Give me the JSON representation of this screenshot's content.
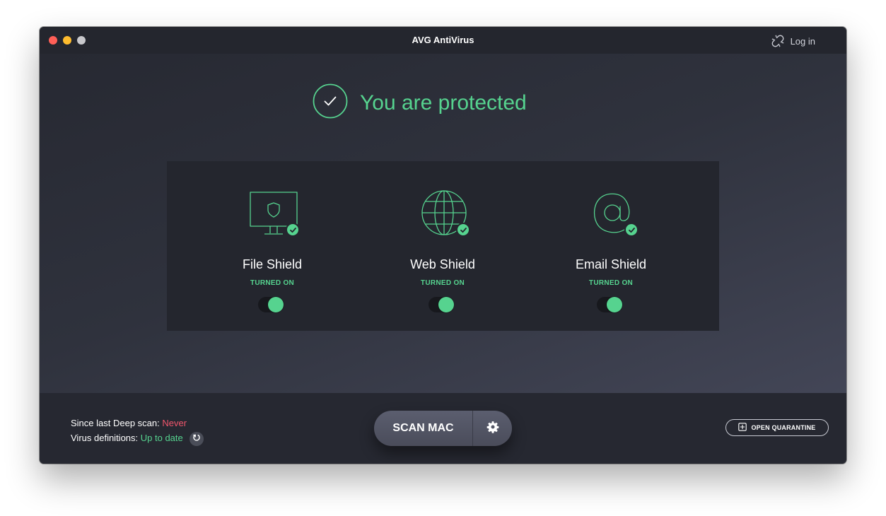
{
  "window": {
    "title": "AVG AntiVirus"
  },
  "header": {
    "login_label": "Log in",
    "login_icon": "broken-link-icon"
  },
  "status": {
    "title": "You are protected",
    "icon": "check-circle-icon",
    "color": "#56d38f"
  },
  "shields": [
    {
      "name": "File Shield",
      "state": "TURNED ON",
      "enabled": true,
      "icon": "monitor-shield-icon"
    },
    {
      "name": "Web Shield",
      "state": "TURNED ON",
      "enabled": true,
      "icon": "globe-icon"
    },
    {
      "name": "Email Shield",
      "state": "TURNED ON",
      "enabled": true,
      "icon": "at-sign-icon"
    }
  ],
  "footer": {
    "deep_scan_label": "Since last Deep scan: ",
    "deep_scan_value": "Never",
    "definitions_label": "Virus definitions: ",
    "definitions_value": "Up to date",
    "scan_button": "SCAN MAC",
    "quarantine_button": "OPEN QUARANTINE"
  },
  "colors": {
    "accent": "#56d38f",
    "warning": "#f0566c"
  }
}
